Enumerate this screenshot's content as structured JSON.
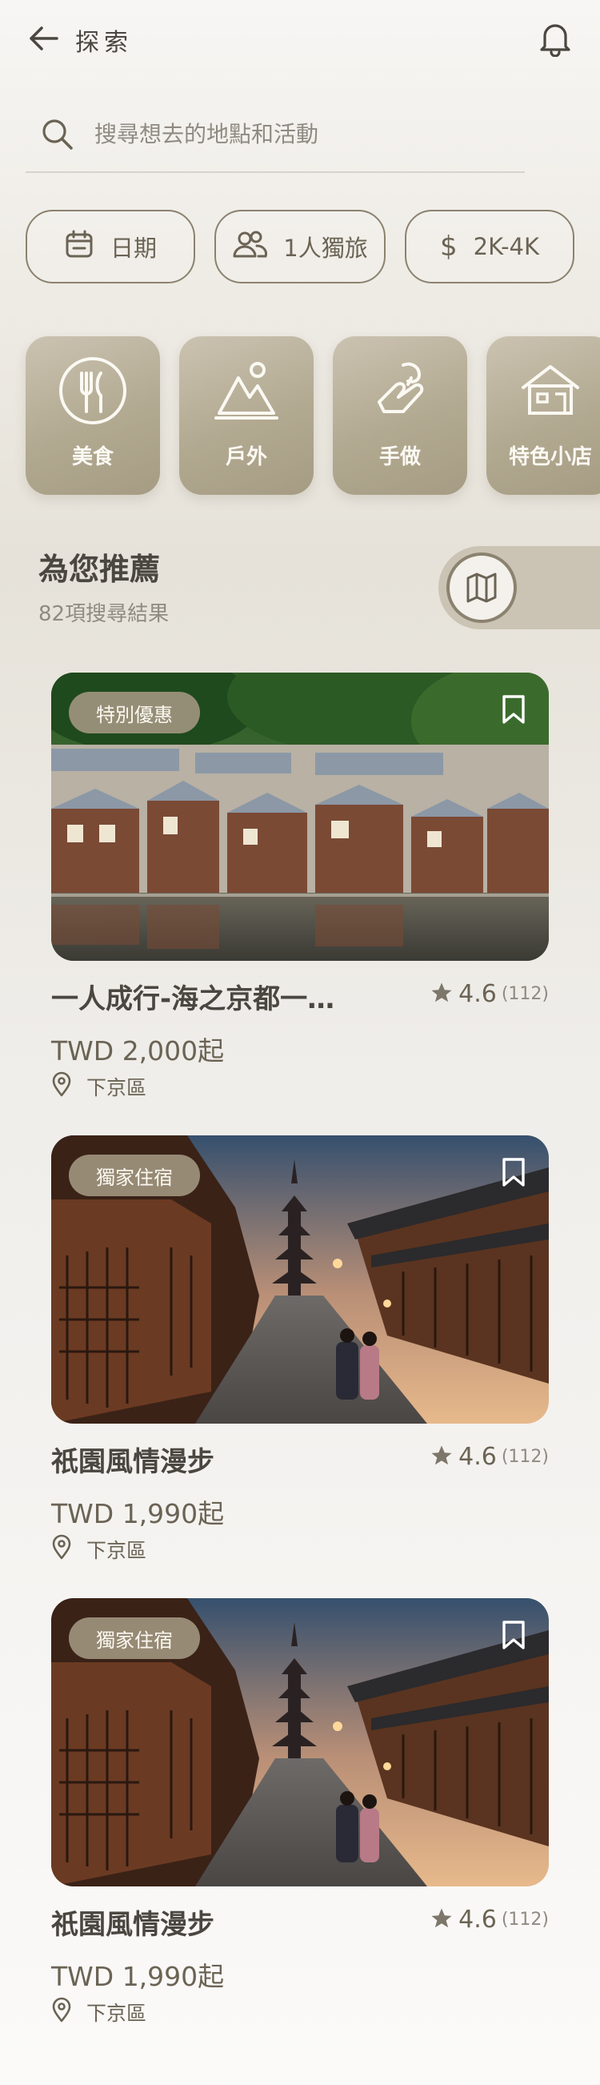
{
  "header": {
    "title": "探索"
  },
  "search": {
    "placeholder": "搜尋想去的地點和活動"
  },
  "filters": [
    {
      "label": "日期",
      "icon": "calendar-icon"
    },
    {
      "label": "1人獨旅",
      "icon": "people-icon"
    },
    {
      "label": "2K-4K",
      "icon": "dollar-icon"
    }
  ],
  "categories": [
    {
      "label": "美食",
      "icon": "fork-knife-icon"
    },
    {
      "label": "戶外",
      "icon": "mountain-icon"
    },
    {
      "label": "手做",
      "icon": "handcraft-icon"
    },
    {
      "label": "特色小店",
      "icon": "shop-icon"
    }
  ],
  "recommendations": {
    "title": "為您推薦",
    "count": "82項搜尋結果",
    "map_icon": "map-icon"
  },
  "cards": [
    {
      "badge": "特別優惠",
      "name": "一人成行-海之京都一…",
      "rating": "4.6",
      "reviews": "(112)",
      "price": "TWD 2,000起",
      "location": "下京區"
    },
    {
      "badge": "獨家住宿",
      "name": "祇園風情漫步",
      "rating": "4.6",
      "reviews": "(112)",
      "price": "TWD 1,990起",
      "location": "下京區"
    },
    {
      "badge": "獨家住宿",
      "name": "祇園風情漫步",
      "rating": "4.6",
      "reviews": "(112)",
      "price": "TWD 1,990起",
      "location": "下京區"
    }
  ],
  "colors": {
    "accent": "#8b826f",
    "text": "#4a4640",
    "muted": "#8f8a82",
    "category_bg": "#b2a991"
  }
}
